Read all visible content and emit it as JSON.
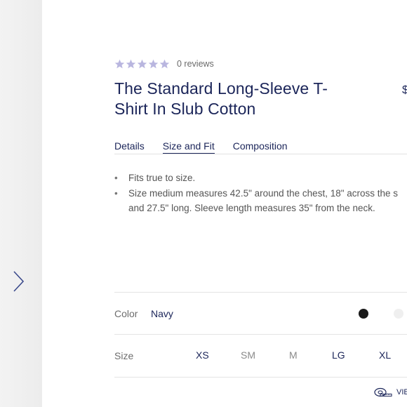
{
  "rating": {
    "stars_filled": 0,
    "stars_total": 5,
    "star_color": "#b9b6df",
    "review_count": "0 reviews"
  },
  "product": {
    "title_line1": "The Standard Long-Sleeve T-",
    "title_line2": "Shirt In Slub Cotton",
    "price_peek": "$"
  },
  "tabs": [
    {
      "label": "Details",
      "active": false
    },
    {
      "label": "Size and Fit",
      "active": true
    },
    {
      "label": "Composition",
      "active": false
    }
  ],
  "size_and_fit": {
    "bullets": [
      {
        "line1": "Fits true to size.",
        "line2": ""
      },
      {
        "line1": "Size medium measures 42.5\" around the chest, 18\" across the s",
        "line2": "and 27.5\" long. Sleeve length measures 35\" from the neck."
      }
    ]
  },
  "color": {
    "label": "Color",
    "selected": "Navy",
    "swatches": [
      {
        "name": "Black",
        "hex": "#1a1a1a"
      },
      {
        "name": "White",
        "hex": "#efefef"
      }
    ]
  },
  "size": {
    "label": "Size",
    "options": [
      "XS",
      "SM",
      "M",
      "LG",
      "XL"
    ]
  },
  "footer": {
    "view_link": "VIE",
    "icon": "measuring-tape-icon"
  },
  "colors": {
    "brand_navy": "#1b2559",
    "text_muted": "#6d6d6d",
    "divider": "#e4e4e4"
  }
}
